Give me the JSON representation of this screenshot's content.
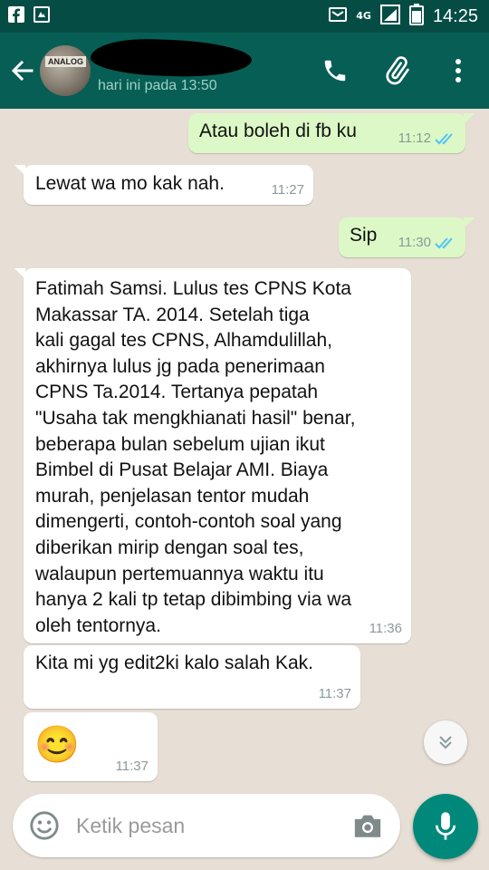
{
  "colors": {
    "status_bar": "#054d44",
    "app_bar": "#075e54",
    "chat_background": "#e7dfd5",
    "incoming_bubble": "#ffffff",
    "outgoing_bubble": "#dcf8c6",
    "read_ticks": "#4fc3f7",
    "mic_button": "#00897b"
  },
  "status_bar": {
    "network": "4G",
    "time": "14:25",
    "icons": [
      "facebook-icon",
      "notification-icon",
      "message-icon",
      "signal-icon",
      "battery-icon"
    ]
  },
  "header": {
    "contact_status": "hari ini pada 13:50",
    "avatar_text": "ANALOG"
  },
  "messages": [
    {
      "direction": "out",
      "text": "Atau boleh di fb ku",
      "time": "11:12",
      "read": true
    },
    {
      "direction": "in",
      "text": "Lewat wa mo kak nah.",
      "time": "11:27"
    },
    {
      "direction": "out",
      "text": "Sip",
      "time": "11:30",
      "read": true
    },
    {
      "direction": "in",
      "text": "Fatimah Samsi. Lulus tes CPNS Kota\nMakassar TA. 2014. Setelah tiga\nkali gagal tes CPNS, Alhamdulillah,\nakhirnya lulus jg pada penerimaan\nCPNS Ta.2014. Tertanya pepatah\n\"Usaha tak mengkhianati hasil\" benar,\nbeberapa bulan sebelum ujian ikut\nBimbel di Pusat Belajar AMI. Biaya\nmurah, penjelasan tentor mudah\ndimengerti, contoh-contoh soal yang\ndiberikan mirip dengan soal tes,\nwalaupun pertemuannya waktu itu\nhanya 2 kali tp tetap dibimbing via wa\noleh tentornya.",
      "time": "11:36"
    },
    {
      "direction": "in",
      "text": "Kita mi yg edit2ki kalo salah Kak.",
      "time": "11:37"
    },
    {
      "direction": "in",
      "text": "😊",
      "time": "11:37"
    }
  ],
  "composer": {
    "placeholder": "Ketik pesan"
  }
}
